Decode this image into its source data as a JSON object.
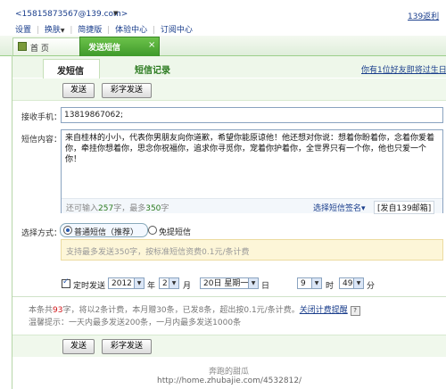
{
  "top": {
    "account": "<15815873567@139.com>",
    "account_arrow": "▼",
    "right_link": "139返利",
    "nav": [
      "设置",
      "换肤",
      "简捷版",
      "体验中心",
      "订阅中心"
    ]
  },
  "tabs": {
    "home": "首 页",
    "active": "发送短信",
    "close": "×"
  },
  "subtabs": {
    "send": "发短信",
    "record": "短信记录",
    "right_link": "你有1位好友即将过生日"
  },
  "toolbar": {
    "send": "发送",
    "color_send": "彩字发送"
  },
  "recipient": {
    "label": "接收手机：",
    "value": "13819867062;"
  },
  "content": {
    "label": "短信内容：",
    "value": "来自桂林的小小，代表你男朋友向你道歉，希望你能原谅他！他还想对你说：想着你盼着你，念着你爱着你，牵挂你想着你，思念你祝福你，追求你寻觅你，宠着你护着你，全世界只有一个你，他也只爱一个你！",
    "counter_prefix": "还可输入",
    "counter_remain": "257",
    "counter_mid": "字，最多",
    "counter_max": "350",
    "counter_suffix": "字",
    "signature_select": "选择短信签名▾",
    "signature_tag": "[发自139邮箱]"
  },
  "method": {
    "label": "选择方式：",
    "option_normal": "普通短信（推荐）",
    "option_free": "免提短信",
    "note": "支持最多发送350字，按标准短信资费0.1元/条计费"
  },
  "schedule": {
    "label": "定时发送",
    "year": "2012",
    "year_unit": "年",
    "month": "2",
    "month_unit": "月",
    "day": "20日 星期一",
    "day_unit": "日",
    "hour": "9",
    "hour_unit": "时",
    "minute": "49",
    "minute_unit": "分"
  },
  "info": {
    "line1_a": "本条共",
    "line1_count": "93",
    "line1_b": "字，将以2条计费，本月赠30条，已发8条，超出按0.1元/条计费。",
    "line1_link": "关闭计费提醒",
    "help": "?",
    "line2": "温馨提示：一天内最多发送200条，一月内最多发送1000条"
  },
  "bottom_toolbar": {
    "send": "发送",
    "color_send": "彩字发送"
  },
  "watermark": {
    "line1": "奔跑的甜瓜",
    "line2": "http://home.zhubajie.com/4532812/"
  }
}
